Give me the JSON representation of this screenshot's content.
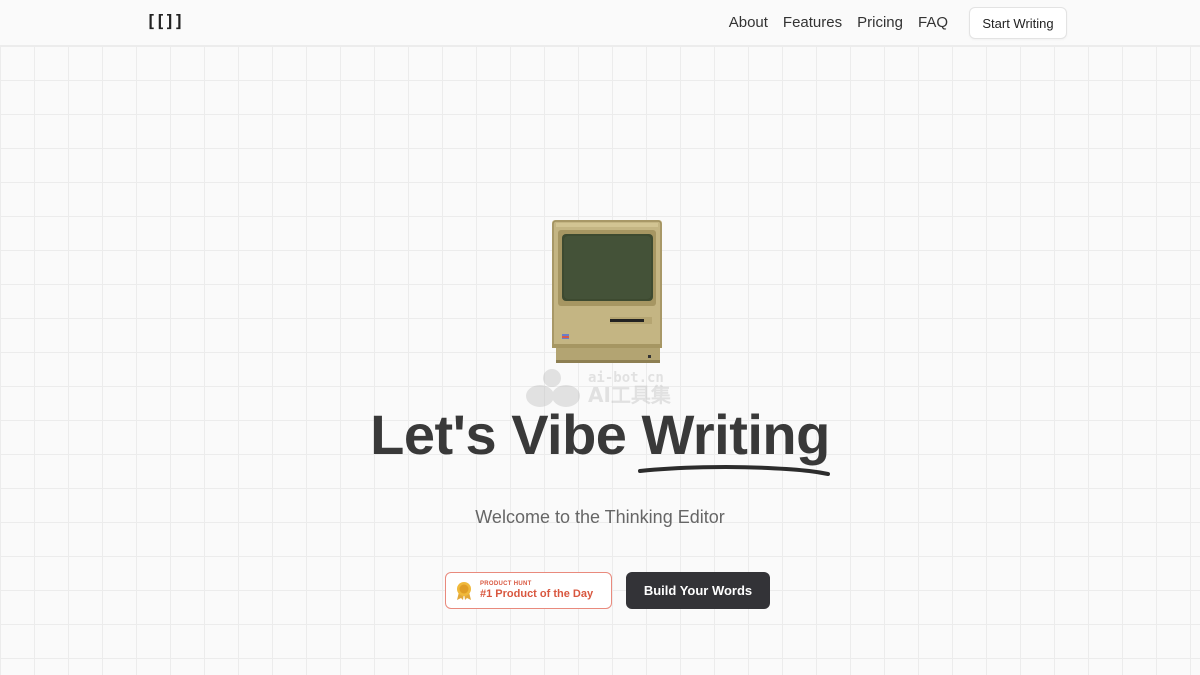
{
  "brand": {
    "logo_text": "[[]]"
  },
  "nav": {
    "links": [
      "About",
      "Features",
      "Pricing",
      "FAQ"
    ],
    "cta_label": "Start Writing"
  },
  "watermark": {
    "url": "ai-bot.cn",
    "name": "AI工具集"
  },
  "hero": {
    "title_prefix": "Let's Vibe ",
    "title_highlight": "Writing",
    "subtitle": "Welcome to the Thinking Editor"
  },
  "product_hunt": {
    "label": "PRODUCT HUNT",
    "award": "#1 Product of the Day",
    "icon": "medal-icon"
  },
  "cta": {
    "build_label": "Build Your Words"
  },
  "colors": {
    "background": "#fafafa",
    "grid": "#ececec",
    "button_dark": "#333337",
    "badge_accent": "#d9573f",
    "mac_body": "#c4b583",
    "mac_screen": "#3d4a30"
  }
}
